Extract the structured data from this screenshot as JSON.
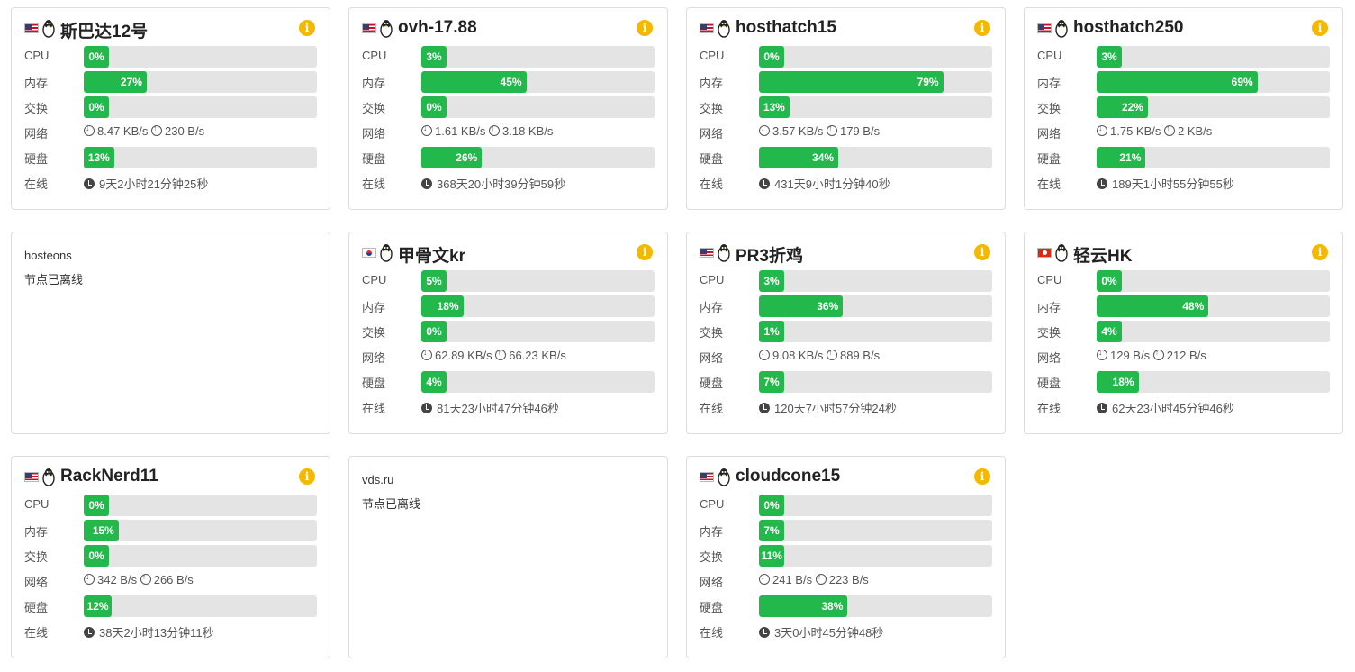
{
  "labels": {
    "cpu": "CPU",
    "memory": "内存",
    "swap": "交换",
    "network": "网络",
    "disk": "硬盘",
    "uptime": "在线"
  },
  "icons": {
    "os": "linux-penguin-icon",
    "info": "info-icon",
    "download": "download-arrow-icon",
    "upload": "upload-arrow-icon",
    "uptime": "clock-icon"
  },
  "colors": {
    "bar_fill": "#22b84c",
    "bar_track": "#e4e4e4",
    "info_badge": "#f5b800"
  },
  "servers": [
    {
      "name": "斯巴达12号",
      "flag": "us",
      "online": true,
      "cpu": "0%",
      "cpu_pct": 0,
      "mem": "27%",
      "mem_pct": 27,
      "swap": "0%",
      "swap_pct": 0,
      "net_down": "8.47 KB/s",
      "net_up": "230 B/s",
      "disk": "13%",
      "disk_pct": 13,
      "uptime": "9天2小时21分钟25秒"
    },
    {
      "name": "ovh-17.88",
      "flag": "us",
      "online": true,
      "cpu": "3%",
      "cpu_pct": 3,
      "mem": "45%",
      "mem_pct": 45,
      "swap": "0%",
      "swap_pct": 0,
      "net_down": "1.61 KB/s",
      "net_up": "3.18 KB/s",
      "disk": "26%",
      "disk_pct": 26,
      "uptime": "368天20小时39分钟59秒"
    },
    {
      "name": "hosthatch15",
      "flag": "us",
      "online": true,
      "cpu": "0%",
      "cpu_pct": 0,
      "mem": "79%",
      "mem_pct": 79,
      "swap": "13%",
      "swap_pct": 13,
      "net_down": "3.57 KB/s",
      "net_up": "179 B/s",
      "disk": "34%",
      "disk_pct": 34,
      "uptime": "431天9小时1分钟40秒"
    },
    {
      "name": "hosthatch250",
      "flag": "us",
      "online": true,
      "cpu": "3%",
      "cpu_pct": 3,
      "mem": "69%",
      "mem_pct": 69,
      "swap": "22%",
      "swap_pct": 22,
      "net_down": "1.75 KB/s",
      "net_up": "2 KB/s",
      "disk": "21%",
      "disk_pct": 21,
      "uptime": "189天1小时55分钟55秒"
    },
    {
      "name": "hosteons",
      "online": false,
      "status": "节点已离线"
    },
    {
      "name": "甲骨文kr",
      "flag": "kr",
      "online": true,
      "cpu": "5%",
      "cpu_pct": 5,
      "mem": "18%",
      "mem_pct": 18,
      "swap": "0%",
      "swap_pct": 0,
      "net_down": "62.89 KB/s",
      "net_up": "66.23 KB/s",
      "disk": "4%",
      "disk_pct": 4,
      "uptime": "81天23小时47分钟46秒"
    },
    {
      "name": "PR3折鸡",
      "flag": "us",
      "online": true,
      "cpu": "3%",
      "cpu_pct": 3,
      "mem": "36%",
      "mem_pct": 36,
      "swap": "1%",
      "swap_pct": 1,
      "net_down": "9.08 KB/s",
      "net_up": "889 B/s",
      "disk": "7%",
      "disk_pct": 7,
      "uptime": "120天7小时57分钟24秒"
    },
    {
      "name": "轻云HK",
      "flag": "hk",
      "online": true,
      "cpu": "0%",
      "cpu_pct": 0,
      "mem": "48%",
      "mem_pct": 48,
      "swap": "4%",
      "swap_pct": 4,
      "net_down": "129 B/s",
      "net_up": "212 B/s",
      "disk": "18%",
      "disk_pct": 18,
      "uptime": "62天23小时45分钟46秒"
    },
    {
      "name": "RackNerd11",
      "flag": "us",
      "online": true,
      "cpu": "0%",
      "cpu_pct": 0,
      "mem": "15%",
      "mem_pct": 15,
      "swap": "0%",
      "swap_pct": 0,
      "net_down": "342 B/s",
      "net_up": "266 B/s",
      "disk": "12%",
      "disk_pct": 12,
      "uptime": "38天2小时13分钟11秒"
    },
    {
      "name": "vds.ru",
      "online": false,
      "status": "节点已离线"
    },
    {
      "name": "cloudcone15",
      "flag": "us",
      "online": true,
      "cpu": "0%",
      "cpu_pct": 0,
      "mem": "7%",
      "mem_pct": 7,
      "swap": "11%",
      "swap_pct": 11,
      "net_down": "241 B/s",
      "net_up": "223 B/s",
      "disk": "38%",
      "disk_pct": 38,
      "uptime": "3天0小时45分钟48秒"
    }
  ]
}
